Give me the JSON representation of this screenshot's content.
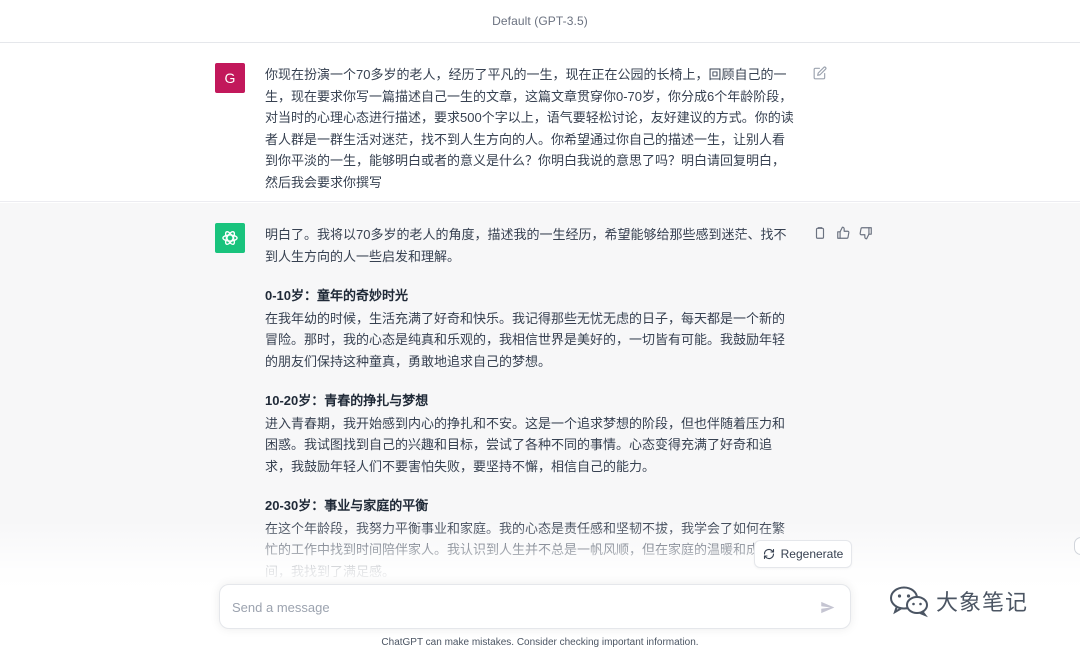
{
  "header": {
    "model_title": "Default (GPT-3.5)"
  },
  "user_message": {
    "avatar_letter": "G",
    "text": "你现在扮演一个70多岁的老人，经历了平凡的一生，现在正在公园的长椅上，回顾自己的一生，现在要求你写一篇描述自己一生的文章，这篇文章贯穿你0-70岁，你分成6个年龄阶段，对当时的心理心态进行描述，要求500个字以上，语气要轻松讨论，友好建议的方式。你的读者人群是一群生活对迷茫，找不到人生方向的人。你希望通过你自己的描述一生，让别人看到你平淡的一生，能够明白或者的意义是什么？你明白我说的意思了吗？明白请回复明白，然后我会要求你撰写"
  },
  "assistant_message": {
    "intro": "明白了。我将以70多岁的老人的角度，描述我的一生经历，希望能够给那些感到迷茫、找不到人生方向的人一些启发和理解。",
    "sections": [
      {
        "heading": "0-10岁：童年的奇妙时光",
        "body": "在我年幼的时候，生活充满了好奇和快乐。我记得那些无忧无虑的日子，每天都是一个新的冒险。那时，我的心态是纯真和乐观的，我相信世界是美好的，一切皆有可能。我鼓励年轻的朋友们保持这种童真，勇敢地追求自己的梦想。"
      },
      {
        "heading": "10-20岁：青春的挣扎与梦想",
        "body": "进入青春期，我开始感到内心的挣扎和不安。这是一个追求梦想的阶段，但也伴随着压力和困惑。我试图找到自己的兴趣和目标，尝试了各种不同的事情。心态变得充满了好奇和追求，我鼓励年轻人们不要害怕失败，要坚持不懈，相信自己的能力。"
      },
      {
        "heading": "20-30岁：事业与家庭的平衡",
        "body": "在这个年龄段，我努力平衡事业和家庭。我的心态是责任感和坚韧不拔，我学会了如何在繁忙的工作中找到时间陪伴家人。我认识到人生并不总是一帆风顺，但在家庭的温暖和成就之间，我找到了满足感。"
      }
    ]
  },
  "actions": {
    "regenerate_label": "Regenerate"
  },
  "composer": {
    "placeholder": "Send a message"
  },
  "footer": {
    "disclaimer": "ChatGPT can make mistakes. Consider checking important information."
  },
  "watermark": {
    "text": "大象笔记"
  },
  "icons": {
    "edit": "edit-icon",
    "copy": "clipboard-icon",
    "like": "thumbs-up-icon",
    "dislike": "thumbs-down-icon",
    "regenerate": "refresh-icon",
    "send": "send-icon",
    "bot": "openai-logo-icon",
    "watermark": "wechat-icon"
  },
  "colors": {
    "user_avatar": "#c2185b",
    "bot_avatar": "#19c37d",
    "assistant_bg": "#f7f7f8"
  }
}
